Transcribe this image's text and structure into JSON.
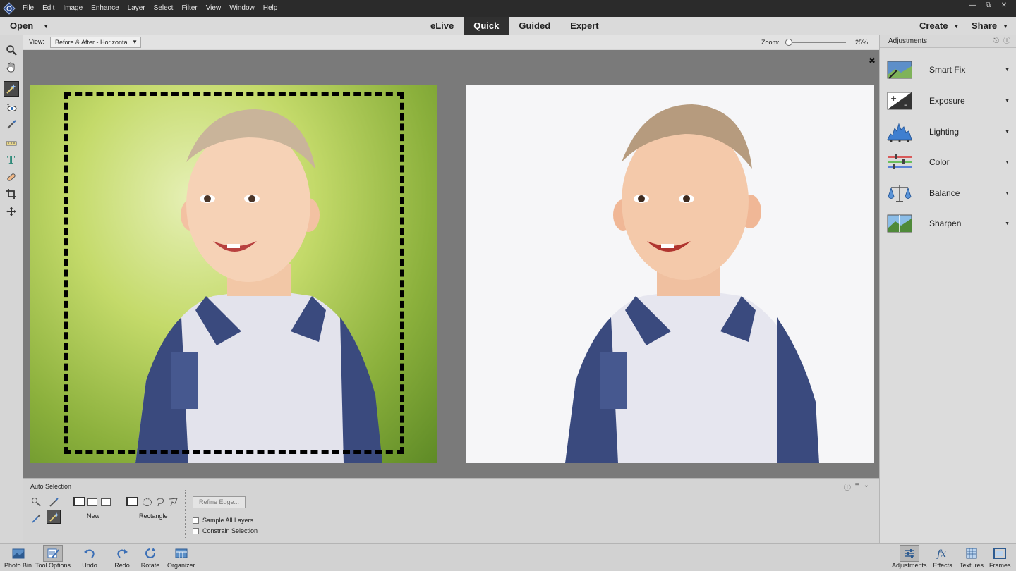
{
  "menubar": {
    "items": [
      "File",
      "Edit",
      "Image",
      "Enhance",
      "Layer",
      "Select",
      "Filter",
      "View",
      "Window",
      "Help"
    ]
  },
  "modebar": {
    "open_label": "Open",
    "tabs": [
      "eLive",
      "Quick",
      "Guided",
      "Expert"
    ],
    "active_tab": "Quick",
    "create_label": "Create",
    "share_label": "Share"
  },
  "viewbar": {
    "view_label": "View:",
    "view_value": "Before & After - Horizontal",
    "zoom_label": "Zoom:",
    "zoom_value": "25%"
  },
  "tool_options": {
    "title": "Auto Selection",
    "mode_label": "New",
    "shape_label": "Rectangle",
    "refine_label": "Refine Edge...",
    "sample_all_layers_label": "Sample All Layers",
    "constrain_selection_label": "Constrain Selection"
  },
  "bottombar": {
    "items": [
      {
        "label": "Photo Bin",
        "icon": "photo-bin-icon"
      },
      {
        "label": "Tool Options",
        "icon": "tool-options-icon"
      },
      {
        "label": "Undo",
        "icon": "undo-icon"
      },
      {
        "label": "Redo",
        "icon": "redo-icon"
      },
      {
        "label": "Rotate",
        "icon": "rotate-icon"
      },
      {
        "label": "Organizer",
        "icon": "organizer-icon"
      }
    ],
    "right_items": [
      {
        "label": "Adjustments",
        "icon": "adjustments-icon"
      },
      {
        "label": "Effects",
        "icon": "effects-icon"
      },
      {
        "label": "Textures",
        "icon": "textures-icon"
      },
      {
        "label": "Frames",
        "icon": "frames-icon"
      }
    ]
  },
  "right_panel": {
    "title": "Adjustments",
    "items": [
      {
        "label": "Smart Fix",
        "icon": "smart-fix-icon"
      },
      {
        "label": "Exposure",
        "icon": "exposure-icon"
      },
      {
        "label": "Lighting",
        "icon": "lighting-icon"
      },
      {
        "label": "Color",
        "icon": "color-icon"
      },
      {
        "label": "Balance",
        "icon": "balance-icon"
      },
      {
        "label": "Sharpen",
        "icon": "sharpen-icon"
      }
    ]
  },
  "colors": {
    "menubar_bg": "#2b2b2b",
    "active_tab_bg": "#303030",
    "canvas_bg": "#7a7a7a",
    "panel_bg": "#dcdcdc",
    "shirt_blue": "#3a4a7e"
  }
}
